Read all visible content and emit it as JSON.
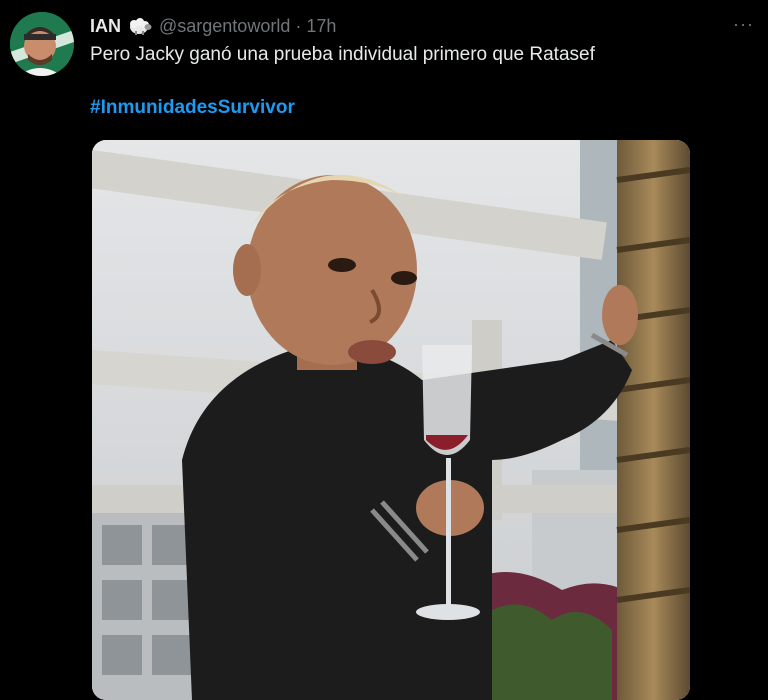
{
  "tweet": {
    "display_name": "IAN",
    "handle": "@sargentoworld",
    "separator": "·",
    "time": "17h",
    "text": "Pero Jacky ganó una prueba individual primero que Ratasef",
    "hashtag": "#InmunidadesSurvivor",
    "more_glyph": "···",
    "badge_icon": "sheep-icon",
    "accent_color": "#1d9bf0"
  }
}
